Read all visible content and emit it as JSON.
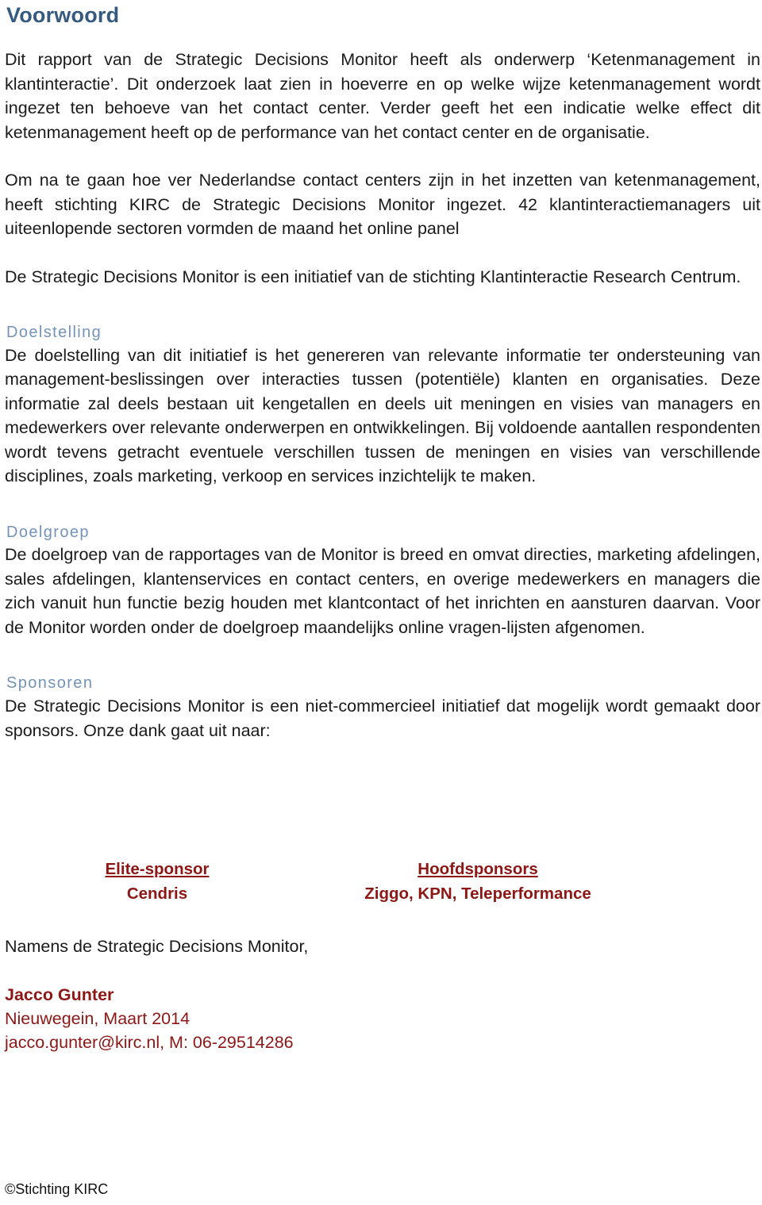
{
  "document": {
    "title": "Voorwoord",
    "footer": "©Stichting KIRC"
  },
  "intro": {
    "paragraph_1": "Dit rapport van de Strategic Decisions Monitor heeft als onderwerp ‘Ketenmanagement in klantinteractie’. Dit onderzoek laat zien in hoeverre en op welke wijze ketenmanagement wordt ingezet ten behoeve van het contact center. Verder geeft het een indicatie welke effect dit ketenmanagement heeft op de performance van het contact center en de organisatie.",
    "paragraph_2": "Om na te gaan hoe ver Nederlandse contact centers zijn in het inzetten van ketenmanagement, heeft stichting KIRC de Strategic Decisions Monitor ingezet. 42 klantinteractiemanagers uit uiteenlopende sectoren vormden de maand het online panel",
    "paragraph_3": "De Strategic Decisions Monitor is een initiatief van de stichting Klantinteractie Research Centrum."
  },
  "sections": [
    {
      "heading": "Doelstelling",
      "body": "De doelstelling van dit initiatief is het genereren van relevante informatie ter ondersteuning van management-beslissingen over interacties tussen (potentiële) klanten en organisaties. Deze informatie zal deels bestaan uit kengetallen en deels uit meningen en visies van managers en medewerkers over relevante onderwerpen en ontwikkelingen. Bij voldoende aantallen respondenten wordt tevens getracht eventuele verschillen tussen de meningen en visies van verschillende disciplines, zoals marketing, verkoop en services inzichtelijk te maken."
    },
    {
      "heading": "Doelgroep",
      "body": "De doelgroep van de rapportages van de Monitor is breed en omvat directies, marketing afdelingen, sales afdelingen, klantenservices en contact centers, en overige medewerkers en managers die zich vanuit hun functie bezig houden met klantcontact of het inrichten en aansturen daarvan. Voor de Monitor worden onder de doelgroep maandelijks online vragen-lijsten afgenomen."
    },
    {
      "heading": "Sponsoren",
      "body": "De Strategic Decisions Monitor is een niet-commercieel initiatief dat mogelijk wordt gemaakt door sponsors. Onze dank gaat uit naar:"
    }
  ],
  "sponsors": {
    "elite_label": "Elite-sponsor",
    "elite_names": "Cendris",
    "main_label": "Hoofdsponsors",
    "main_names": "Ziggo, KPN, Teleperformance"
  },
  "signoff": {
    "closing": "Namens de Strategic Decisions Monitor,",
    "name": "Jacco Gunter",
    "place_date": "Nieuwegein, Maart 2014",
    "contact": "jacco.gunter@kirc.nl, M: 06-29514286"
  },
  "colors": {
    "title_blue": "#35597F",
    "subheading_blue": "#7393B8",
    "accent_red": "#8C1715",
    "body_black": "#1a1a1a"
  }
}
